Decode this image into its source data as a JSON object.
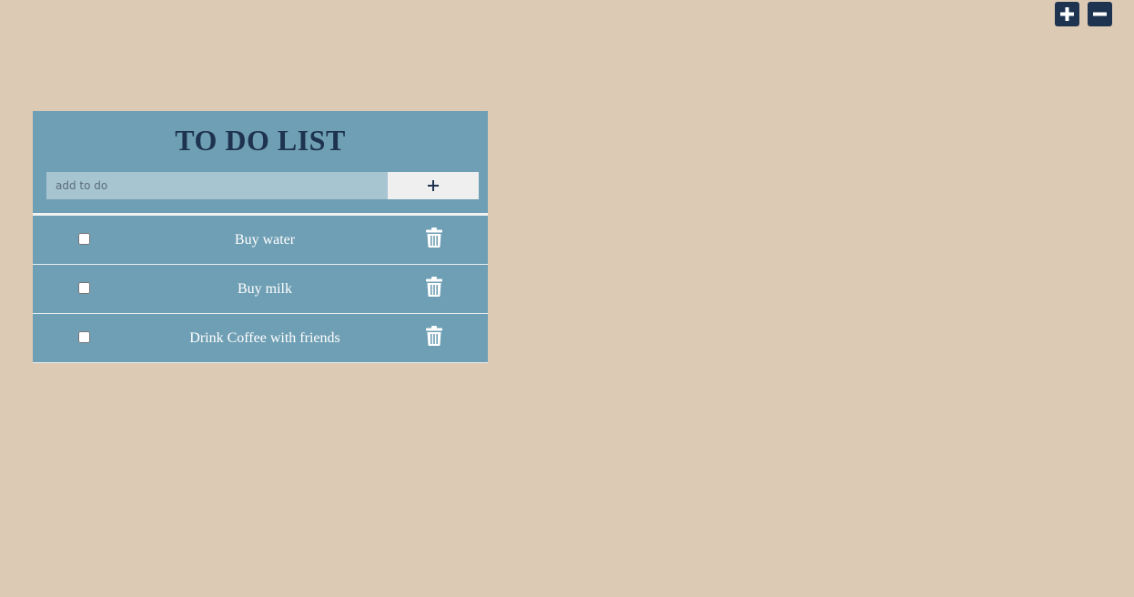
{
  "zoom": {
    "increase_icon": "plus-square-icon",
    "decrease_icon": "minus-square-icon"
  },
  "todo": {
    "title": "TO DO LIST",
    "input_placeholder": "add to do",
    "input_value": "",
    "add_button_symbol": "+",
    "items": [
      {
        "text": "Buy water",
        "checked": false
      },
      {
        "text": "Buy milk",
        "checked": false
      },
      {
        "text": "Drink Coffee with friends",
        "checked": false
      }
    ],
    "delete_icon": "trash-icon"
  },
  "colors": {
    "background": "#dccab5",
    "panel": "#6f9fb4",
    "input": "#a7c4d1",
    "accent_dark": "#1e3350",
    "add_button": "#efefef"
  }
}
